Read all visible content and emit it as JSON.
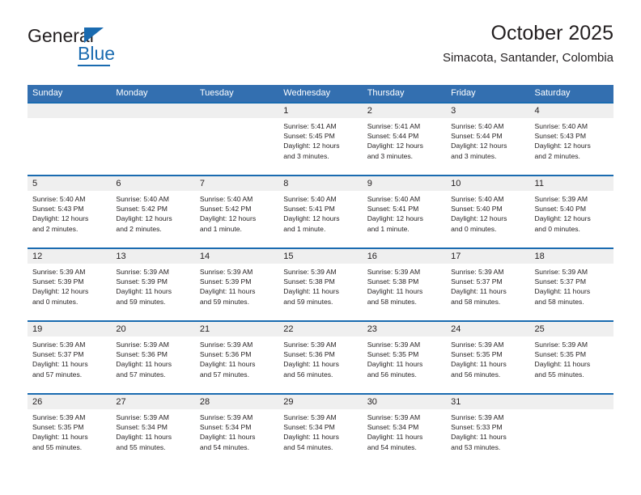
{
  "brand": {
    "name_top": "General",
    "name_bottom": "Blue",
    "accent_color": "#1a6bb0"
  },
  "header": {
    "title": "October 2025",
    "subtitle": "Simacota, Santander, Colombia"
  },
  "colors": {
    "header_blue": "#336fb0",
    "rule_blue": "#1a6bb0",
    "daynum_band": "#efefef",
    "text": "#231f20"
  },
  "calendar": {
    "weekday_headers": [
      "Sunday",
      "Monday",
      "Tuesday",
      "Wednesday",
      "Thursday",
      "Friday",
      "Saturday"
    ],
    "labels": {
      "sunrise": "Sunrise:",
      "sunset": "Sunset:",
      "daylight": "Daylight:"
    },
    "weeks": [
      [
        {
          "day": "",
          "sunrise": "",
          "sunset": "",
          "daylight_line1": "",
          "daylight_line2": ""
        },
        {
          "day": "",
          "sunrise": "",
          "sunset": "",
          "daylight_line1": "",
          "daylight_line2": ""
        },
        {
          "day": "",
          "sunrise": "",
          "sunset": "",
          "daylight_line1": "",
          "daylight_line2": ""
        },
        {
          "day": "1",
          "sunrise": "Sunrise: 5:41 AM",
          "sunset": "Sunset: 5:45 PM",
          "daylight_line1": "Daylight: 12 hours",
          "daylight_line2": "and 3 minutes."
        },
        {
          "day": "2",
          "sunrise": "Sunrise: 5:41 AM",
          "sunset": "Sunset: 5:44 PM",
          "daylight_line1": "Daylight: 12 hours",
          "daylight_line2": "and 3 minutes."
        },
        {
          "day": "3",
          "sunrise": "Sunrise: 5:40 AM",
          "sunset": "Sunset: 5:44 PM",
          "daylight_line1": "Daylight: 12 hours",
          "daylight_line2": "and 3 minutes."
        },
        {
          "day": "4",
          "sunrise": "Sunrise: 5:40 AM",
          "sunset": "Sunset: 5:43 PM",
          "daylight_line1": "Daylight: 12 hours",
          "daylight_line2": "and 2 minutes."
        }
      ],
      [
        {
          "day": "5",
          "sunrise": "Sunrise: 5:40 AM",
          "sunset": "Sunset: 5:43 PM",
          "daylight_line1": "Daylight: 12 hours",
          "daylight_line2": "and 2 minutes."
        },
        {
          "day": "6",
          "sunrise": "Sunrise: 5:40 AM",
          "sunset": "Sunset: 5:42 PM",
          "daylight_line1": "Daylight: 12 hours",
          "daylight_line2": "and 2 minutes."
        },
        {
          "day": "7",
          "sunrise": "Sunrise: 5:40 AM",
          "sunset": "Sunset: 5:42 PM",
          "daylight_line1": "Daylight: 12 hours",
          "daylight_line2": "and 1 minute."
        },
        {
          "day": "8",
          "sunrise": "Sunrise: 5:40 AM",
          "sunset": "Sunset: 5:41 PM",
          "daylight_line1": "Daylight: 12 hours",
          "daylight_line2": "and 1 minute."
        },
        {
          "day": "9",
          "sunrise": "Sunrise: 5:40 AM",
          "sunset": "Sunset: 5:41 PM",
          "daylight_line1": "Daylight: 12 hours",
          "daylight_line2": "and 1 minute."
        },
        {
          "day": "10",
          "sunrise": "Sunrise: 5:40 AM",
          "sunset": "Sunset: 5:40 PM",
          "daylight_line1": "Daylight: 12 hours",
          "daylight_line2": "and 0 minutes."
        },
        {
          "day": "11",
          "sunrise": "Sunrise: 5:39 AM",
          "sunset": "Sunset: 5:40 PM",
          "daylight_line1": "Daylight: 12 hours",
          "daylight_line2": "and 0 minutes."
        }
      ],
      [
        {
          "day": "12",
          "sunrise": "Sunrise: 5:39 AM",
          "sunset": "Sunset: 5:39 PM",
          "daylight_line1": "Daylight: 12 hours",
          "daylight_line2": "and 0 minutes."
        },
        {
          "day": "13",
          "sunrise": "Sunrise: 5:39 AM",
          "sunset": "Sunset: 5:39 PM",
          "daylight_line1": "Daylight: 11 hours",
          "daylight_line2": "and 59 minutes."
        },
        {
          "day": "14",
          "sunrise": "Sunrise: 5:39 AM",
          "sunset": "Sunset: 5:39 PM",
          "daylight_line1": "Daylight: 11 hours",
          "daylight_line2": "and 59 minutes."
        },
        {
          "day": "15",
          "sunrise": "Sunrise: 5:39 AM",
          "sunset": "Sunset: 5:38 PM",
          "daylight_line1": "Daylight: 11 hours",
          "daylight_line2": "and 59 minutes."
        },
        {
          "day": "16",
          "sunrise": "Sunrise: 5:39 AM",
          "sunset": "Sunset: 5:38 PM",
          "daylight_line1": "Daylight: 11 hours",
          "daylight_line2": "and 58 minutes."
        },
        {
          "day": "17",
          "sunrise": "Sunrise: 5:39 AM",
          "sunset": "Sunset: 5:37 PM",
          "daylight_line1": "Daylight: 11 hours",
          "daylight_line2": "and 58 minutes."
        },
        {
          "day": "18",
          "sunrise": "Sunrise: 5:39 AM",
          "sunset": "Sunset: 5:37 PM",
          "daylight_line1": "Daylight: 11 hours",
          "daylight_line2": "and 58 minutes."
        }
      ],
      [
        {
          "day": "19",
          "sunrise": "Sunrise: 5:39 AM",
          "sunset": "Sunset: 5:37 PM",
          "daylight_line1": "Daylight: 11 hours",
          "daylight_line2": "and 57 minutes."
        },
        {
          "day": "20",
          "sunrise": "Sunrise: 5:39 AM",
          "sunset": "Sunset: 5:36 PM",
          "daylight_line1": "Daylight: 11 hours",
          "daylight_line2": "and 57 minutes."
        },
        {
          "day": "21",
          "sunrise": "Sunrise: 5:39 AM",
          "sunset": "Sunset: 5:36 PM",
          "daylight_line1": "Daylight: 11 hours",
          "daylight_line2": "and 57 minutes."
        },
        {
          "day": "22",
          "sunrise": "Sunrise: 5:39 AM",
          "sunset": "Sunset: 5:36 PM",
          "daylight_line1": "Daylight: 11 hours",
          "daylight_line2": "and 56 minutes."
        },
        {
          "day": "23",
          "sunrise": "Sunrise: 5:39 AM",
          "sunset": "Sunset: 5:35 PM",
          "daylight_line1": "Daylight: 11 hours",
          "daylight_line2": "and 56 minutes."
        },
        {
          "day": "24",
          "sunrise": "Sunrise: 5:39 AM",
          "sunset": "Sunset: 5:35 PM",
          "daylight_line1": "Daylight: 11 hours",
          "daylight_line2": "and 56 minutes."
        },
        {
          "day": "25",
          "sunrise": "Sunrise: 5:39 AM",
          "sunset": "Sunset: 5:35 PM",
          "daylight_line1": "Daylight: 11 hours",
          "daylight_line2": "and 55 minutes."
        }
      ],
      [
        {
          "day": "26",
          "sunrise": "Sunrise: 5:39 AM",
          "sunset": "Sunset: 5:35 PM",
          "daylight_line1": "Daylight: 11 hours",
          "daylight_line2": "and 55 minutes."
        },
        {
          "day": "27",
          "sunrise": "Sunrise: 5:39 AM",
          "sunset": "Sunset: 5:34 PM",
          "daylight_line1": "Daylight: 11 hours",
          "daylight_line2": "and 55 minutes."
        },
        {
          "day": "28",
          "sunrise": "Sunrise: 5:39 AM",
          "sunset": "Sunset: 5:34 PM",
          "daylight_line1": "Daylight: 11 hours",
          "daylight_line2": "and 54 minutes."
        },
        {
          "day": "29",
          "sunrise": "Sunrise: 5:39 AM",
          "sunset": "Sunset: 5:34 PM",
          "daylight_line1": "Daylight: 11 hours",
          "daylight_line2": "and 54 minutes."
        },
        {
          "day": "30",
          "sunrise": "Sunrise: 5:39 AM",
          "sunset": "Sunset: 5:34 PM",
          "daylight_line1": "Daylight: 11 hours",
          "daylight_line2": "and 54 minutes."
        },
        {
          "day": "31",
          "sunrise": "Sunrise: 5:39 AM",
          "sunset": "Sunset: 5:33 PM",
          "daylight_line1": "Daylight: 11 hours",
          "daylight_line2": "and 53 minutes."
        },
        {
          "day": "",
          "sunrise": "",
          "sunset": "",
          "daylight_line1": "",
          "daylight_line2": ""
        }
      ]
    ]
  }
}
